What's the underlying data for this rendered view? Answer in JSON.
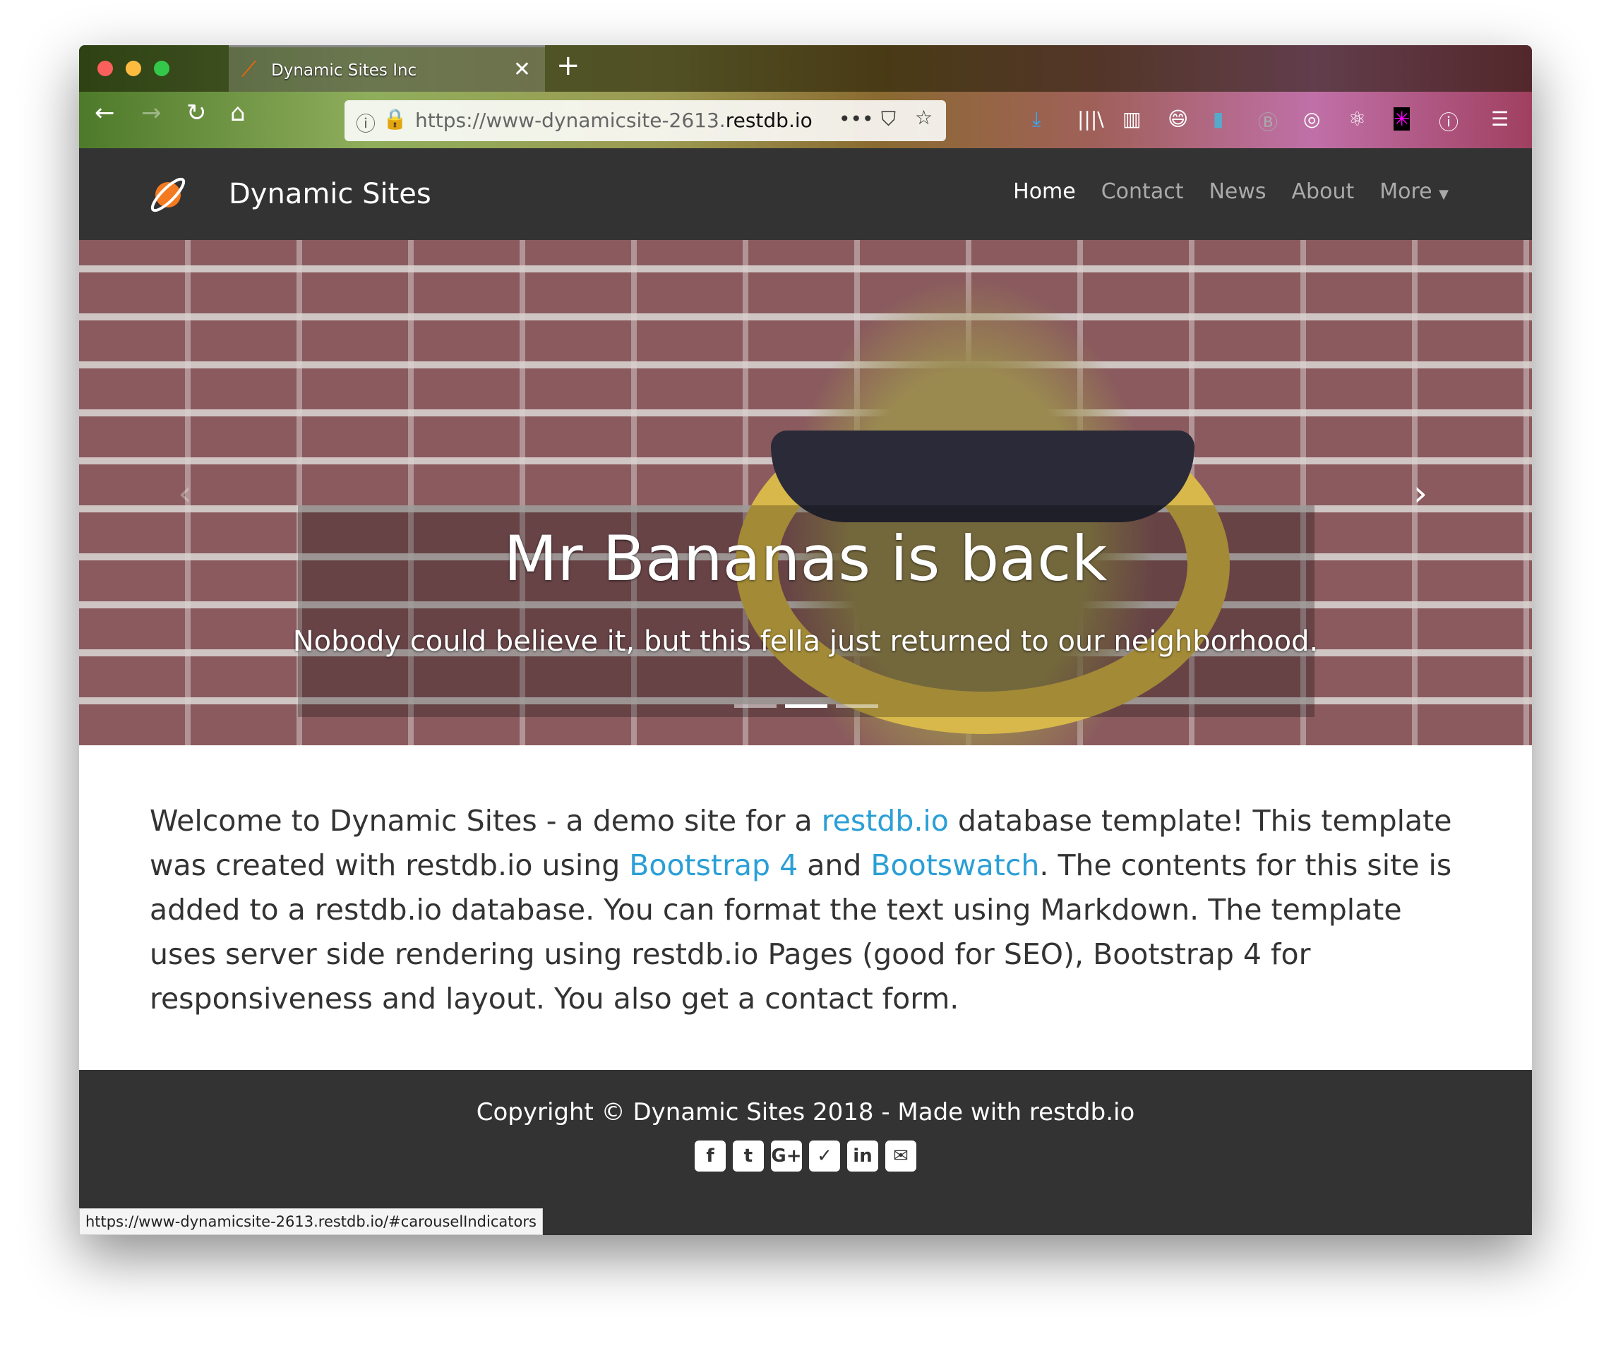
{
  "browser": {
    "tab_title": "Dynamic Sites Inc",
    "url_prefix": "https://www-dynamicsite-2613.",
    "url_domain": "restdb.io",
    "status_url": "https://www-dynamicsite-2613.restdb.io/#carouselIndicators",
    "icons": [
      "back-icon",
      "forward-icon",
      "reload-icon",
      "home-icon",
      "info-icon",
      "lock-icon",
      "more-icon",
      "pocket-icon",
      "star-icon",
      "download-icon",
      "library-icon",
      "sidebar-icon",
      "emoji-icon",
      "bookmark-icon",
      "b-icon",
      "sync-icon",
      "react-icon",
      "spark-icon",
      "1password-icon",
      "menu-icon"
    ]
  },
  "navbar": {
    "brand": "Dynamic Sites",
    "links": [
      {
        "label": "Home",
        "active": true
      },
      {
        "label": "Contact"
      },
      {
        "label": "News"
      },
      {
        "label": "About"
      },
      {
        "label": "More"
      }
    ]
  },
  "hero": {
    "title": "Mr Bananas is back",
    "subtitle": "Nobody could believe it, but this fella just returned to our neighborhood.",
    "slides": 3,
    "active_slide": 2
  },
  "content": {
    "t1": "Welcome to Dynamic Sites - a demo site for a ",
    "l1": "restdb.io",
    "t2": " database template! This template was created with restdb.io using ",
    "l2": "Bootstrap 4",
    "t3": " and ",
    "l3": "Bootswatch",
    "t4": ". The contents for this site is added to a restdb.io database. You can format the text using Markdown. The template uses server side rendering using restdb.io Pages (good for SEO), Bootstrap 4 for responsiveness and layout. You also get a contact form."
  },
  "footer": {
    "copyright": "Copyright © Dynamic Sites 2018 - Made with restdb.io",
    "social": [
      {
        "name": "facebook-icon",
        "g": "f"
      },
      {
        "name": "twitter-icon",
        "g": "t"
      },
      {
        "name": "google-plus-icon",
        "g": "G+"
      },
      {
        "name": "pocket-icon",
        "g": "✓"
      },
      {
        "name": "linkedin-icon",
        "g": "in"
      },
      {
        "name": "email-icon",
        "g": "✉"
      }
    ]
  },
  "colors": {
    "navbar": "#333333",
    "link": "#2a9fd6"
  }
}
